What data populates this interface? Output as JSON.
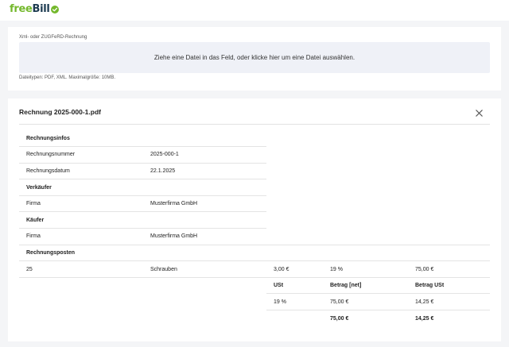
{
  "header": {
    "logo_free": "free",
    "logo_bill": "Bill",
    "logo_icon": "check-circle-icon",
    "colors": {
      "brand_green": "#74b82c",
      "brand_dark": "#1c3a50"
    }
  },
  "upload": {
    "label": "Xml- oder ZUGFeRD-Rechnung",
    "dropzone_text": "Ziehe eine Datei in das Feld, oder klicke hier um eine Datei auswählen.",
    "hint": "Dateitypen: PDF, XML. Maximalgröße: 10MB."
  },
  "invoice": {
    "title": "Rechnung 2025-000-1.pdf",
    "close_icon": "close-icon",
    "sections": {
      "info": "Rechnungsinfos",
      "seller": "Verkäufer",
      "buyer": "Käufer",
      "items": "Rechnungsposten"
    },
    "fields": {
      "number_label": "Rechnungsnummer",
      "number_value": "2025-000-1",
      "date_label": "Rechnungsdatum",
      "date_value": "22.1.2025",
      "seller_firm_label": "Firma",
      "seller_firm_value": "Musterfirma GmbH",
      "buyer_firm_label": "Firma",
      "buyer_firm_value": "Musterfirma GmbH"
    },
    "item": {
      "quantity": "25",
      "description": "Schrauben",
      "price": "3,00 €",
      "tax": "19 %",
      "total": "75,00 €"
    },
    "totals_table": {
      "headers": [
        "USt",
        "Betrag [net]",
        "Betrag USt"
      ],
      "row": [
        "19 %",
        "75,00 €",
        "14,25 €"
      ],
      "sum": [
        "",
        "75,00 €",
        "14,25 €"
      ]
    }
  }
}
